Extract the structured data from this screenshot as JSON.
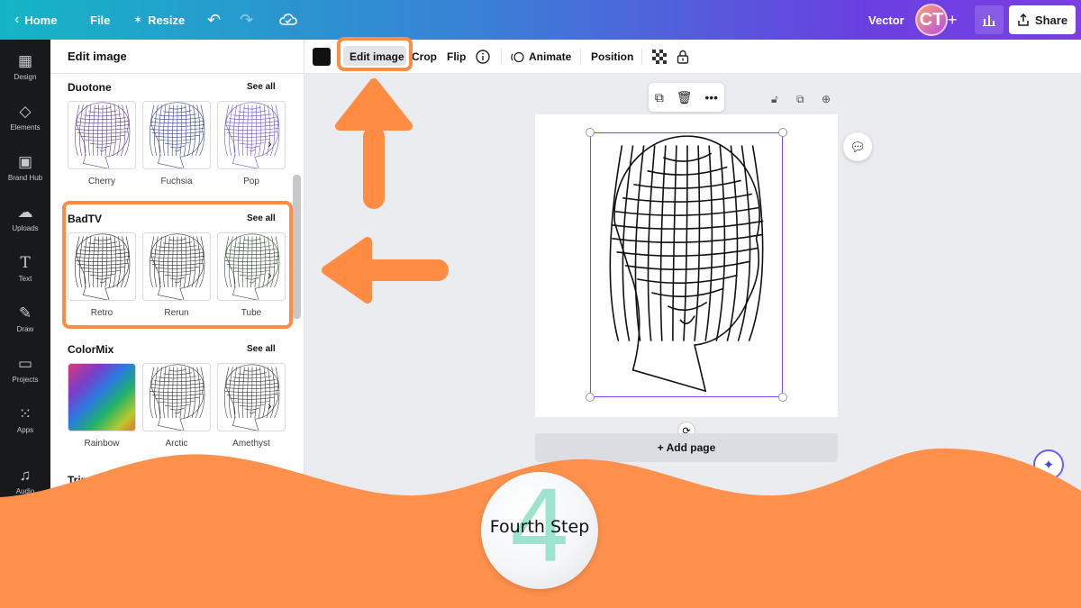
{
  "topbar": {
    "home": "Home",
    "file": "File",
    "resize": "Resize",
    "doc_title": "Vector",
    "avatar_initials": "CT",
    "share": "Share"
  },
  "rail": {
    "items": [
      {
        "label": "Design",
        "icon": "layout-icon"
      },
      {
        "label": "Elements",
        "icon": "shapes-icon"
      },
      {
        "label": "Brand Hub",
        "icon": "brand-icon"
      },
      {
        "label": "Uploads",
        "icon": "cloud-upload-icon"
      },
      {
        "label": "Text",
        "icon": "text-icon"
      },
      {
        "label": "Draw",
        "icon": "pen-icon"
      },
      {
        "label": "Projects",
        "icon": "folder-icon"
      },
      {
        "label": "Apps",
        "icon": "grid-icon"
      },
      {
        "label": "Audio",
        "icon": "music-icon"
      }
    ]
  },
  "panel": {
    "title": "Edit image",
    "see_all": "See all",
    "sections": [
      {
        "title": "Duotone",
        "items": [
          "Cherry",
          "Fuchsia",
          "Pop"
        ]
      },
      {
        "title": "BadTV",
        "items": [
          "Retro",
          "Rerun",
          "Tube"
        ]
      },
      {
        "title": "ColorMix",
        "items": [
          "Rainbow",
          "Arctic",
          "Amethyst"
        ]
      },
      {
        "title": "Trippy",
        "items": []
      }
    ]
  },
  "toolbar": {
    "edit_image": "Edit image",
    "crop": "Crop",
    "flip": "Flip",
    "animate": "Animate",
    "position": "Position"
  },
  "canvas": {
    "add_page": "+ Add page"
  },
  "overlay": {
    "step_number": "4",
    "step_text": "Fourth Step"
  },
  "colors": {
    "accent_orange": "#ff8c42",
    "selection_purple": "#8b3dff",
    "step_number_green": "#9ee3cd"
  }
}
